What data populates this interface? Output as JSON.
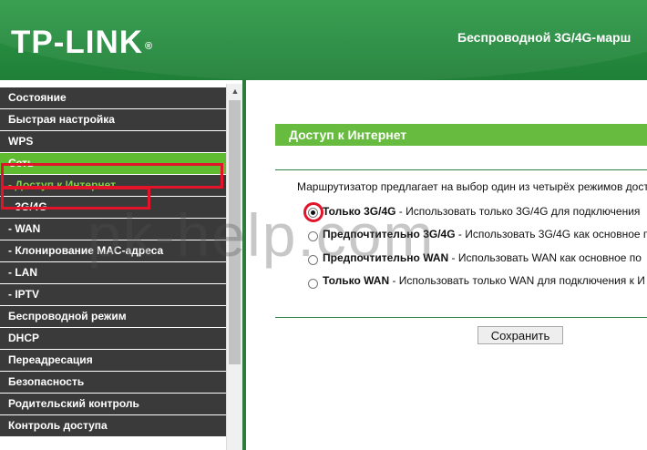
{
  "header": {
    "logo_text": "TP-LINK",
    "logo_mark": "®",
    "title": "Беспроводной 3G/4G-марш"
  },
  "sidebar": {
    "items": [
      {
        "label": "Состояние"
      },
      {
        "label": "Быстрая настройка"
      },
      {
        "label": "WPS"
      },
      {
        "label": "Сеть"
      },
      {
        "label": "- Доступ к Интернет"
      },
      {
        "label": "- 3G/4G"
      },
      {
        "label": "- WAN"
      },
      {
        "label": "- Клонирование MAC-адреса"
      },
      {
        "label": "- LAN"
      },
      {
        "label": "- IPTV"
      },
      {
        "label": "Беспроводной режим"
      },
      {
        "label": "DHCP"
      },
      {
        "label": "Переадресация"
      },
      {
        "label": "Безопасность"
      },
      {
        "label": "Родительский контроль"
      },
      {
        "label": "Контроль доступа"
      }
    ],
    "active_item": "Сеть",
    "active_subitem": "- Доступ к Интернет",
    "scroll_up_icon": "arrow-up-icon"
  },
  "main": {
    "section_title": "Доступ к Интернет",
    "description": "Маршрутизатор предлагает на выбор один из четырёх режимов дост",
    "options": [
      {
        "title": "Только 3G/4G",
        "text": " - Использовать только 3G/4G для подключения",
        "selected": true
      },
      {
        "title": "Предпочтительно 3G/4G",
        "text": " - Использовать 3G/4G как основное п",
        "selected": false
      },
      {
        "title": "Предпочтительно WAN",
        "text": " - Использовать WAN как основное по",
        "selected": false
      },
      {
        "title": "Только WAN",
        "text": " - Использовать только WAN для подключения к И",
        "selected": false
      }
    ],
    "save_label": "Сохранить"
  },
  "watermark": "pk-help.com",
  "colors": {
    "header_green": "#26893e",
    "menu_dark": "#3a3a3a",
    "menu_active": "#5fbb2f",
    "section_title_bg": "#67bb3e",
    "highlight_red": "#e3132a"
  }
}
